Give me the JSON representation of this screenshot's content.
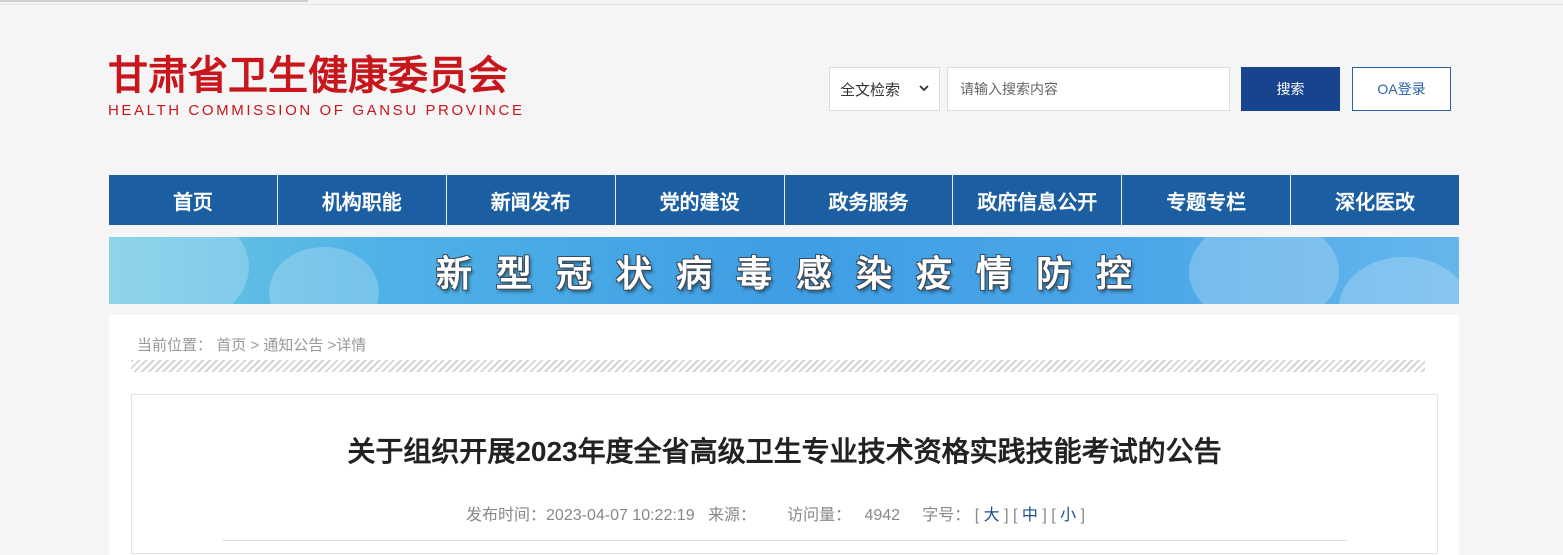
{
  "header": {
    "logo_cn": "甘肃省卫生健康委员会",
    "logo_en": "HEALTH COMMISSION OF GANSU PROVINCE",
    "search_scope": "全文检索",
    "search_placeholder": "请输入搜索内容",
    "search_label": "搜索",
    "oa_label": "OA登录"
  },
  "nav": {
    "items": [
      "首页",
      "机构职能",
      "新闻发布",
      "党的建设",
      "政务服务",
      "政府信息公开",
      "专题专栏",
      "深化医改"
    ]
  },
  "banner": {
    "text": "新型冠状病毒感染疫情防控"
  },
  "breadcrumb": {
    "prefix": "当前位置：",
    "home": "首页",
    "sep1": " > ",
    "section": "通知公告",
    "current": " >详情"
  },
  "article": {
    "title": "关于组织开展2023年度全省高级卫生专业技术资格实践技能考试的公告",
    "publish_label": "发布时间：",
    "publish_time": "2023-04-07 10:22:19",
    "source_label": "来源：",
    "source_value": "",
    "views_label": "访问量：",
    "views": "4942",
    "fontsize_label": "字号：",
    "size_large": "大",
    "size_medium": "中",
    "size_small": "小"
  },
  "colors": {
    "brand_red": "#c8161d",
    "nav_blue": "#1b5ea2",
    "button_blue": "#17438f"
  }
}
